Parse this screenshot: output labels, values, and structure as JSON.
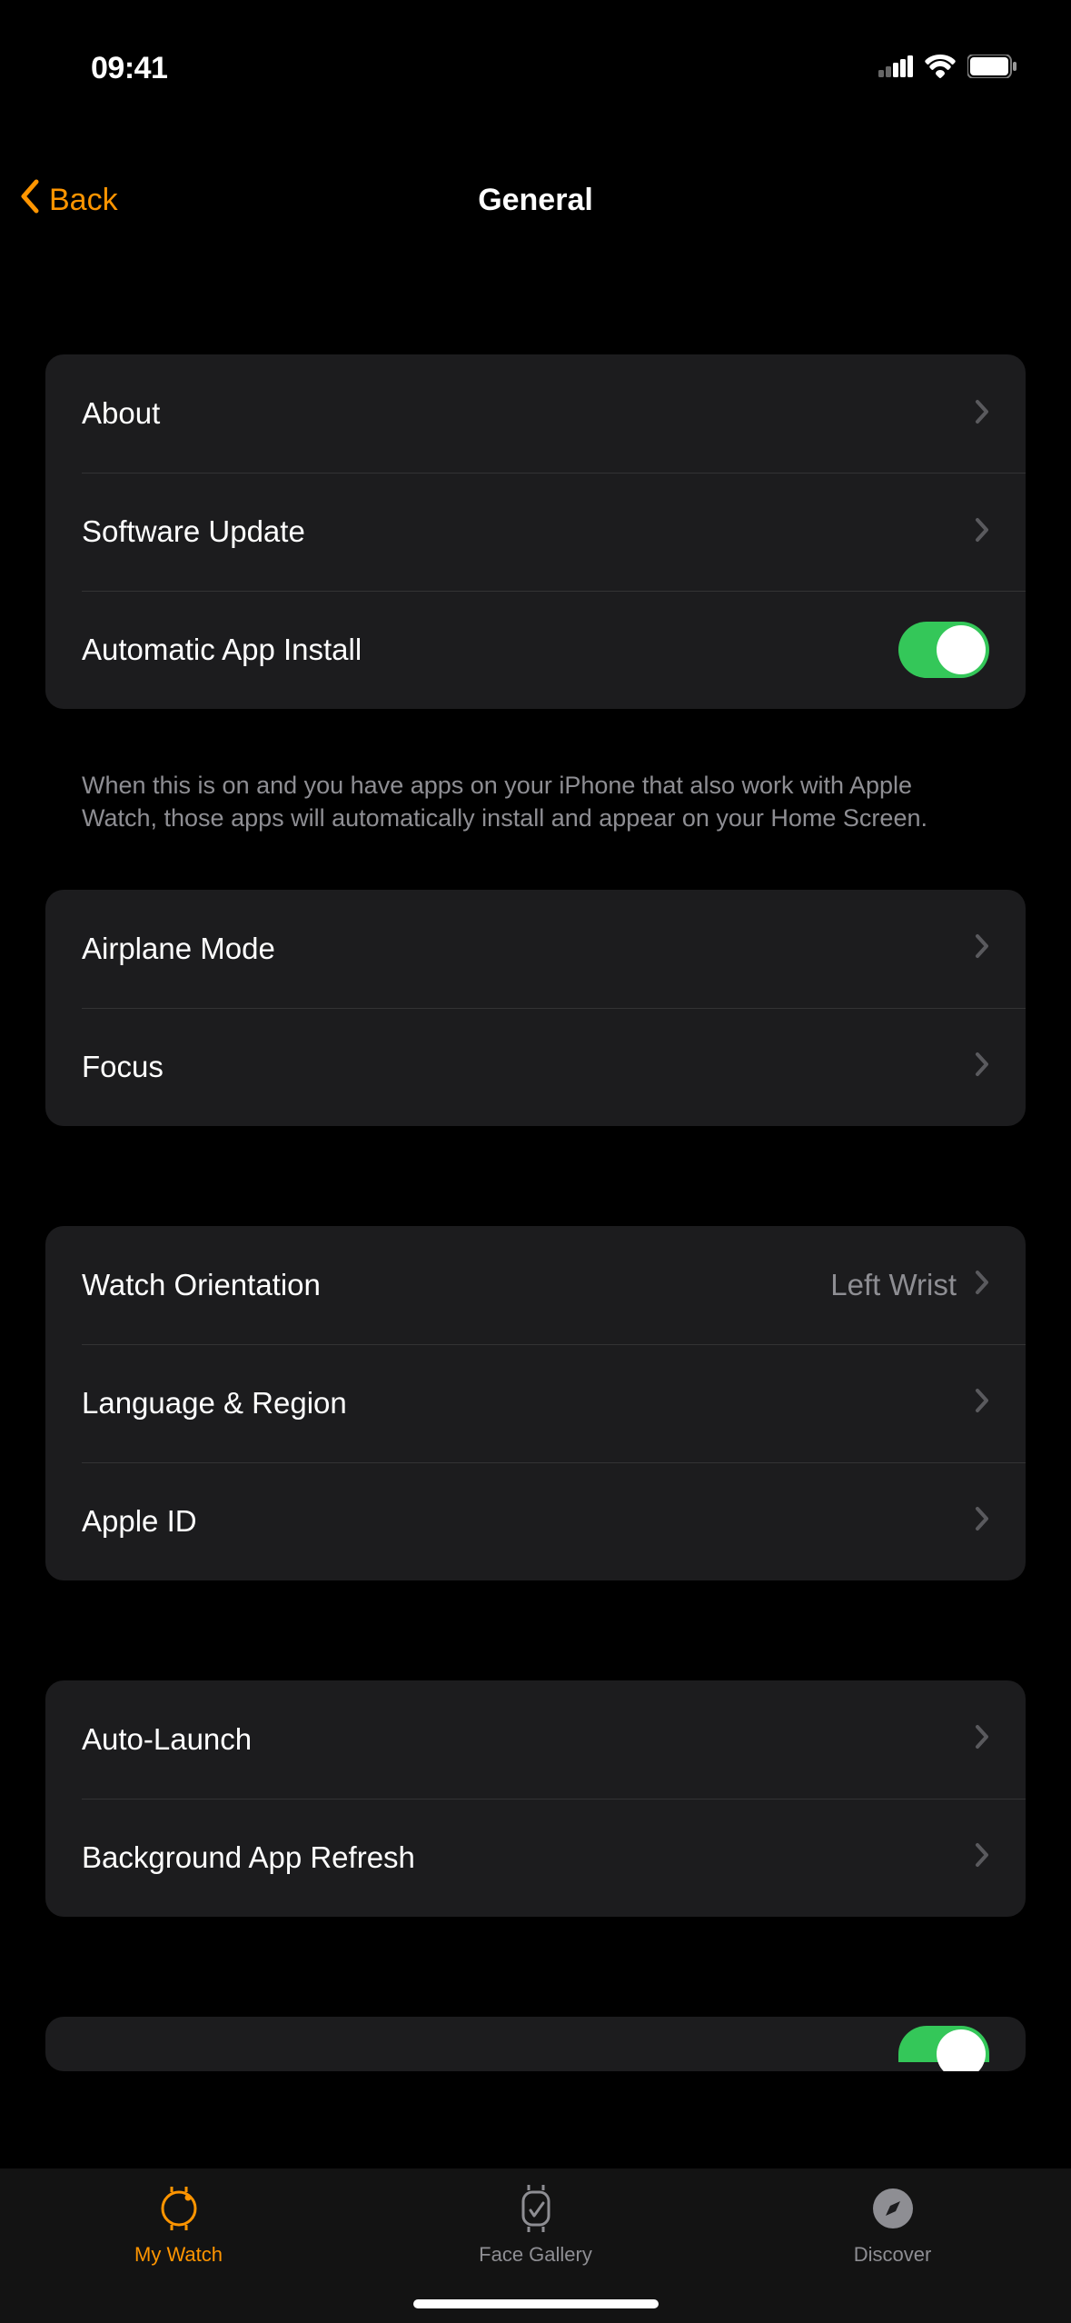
{
  "status": {
    "time": "09:41"
  },
  "nav": {
    "back": "Back",
    "title": "General"
  },
  "groups": {
    "g1": {
      "about": "About",
      "software_update": "Software Update",
      "auto_install": "Automatic App Install",
      "footer": "When this is on and you have apps on your iPhone that also work with Apple Watch, those apps will automatically install and appear on your Home Screen."
    },
    "g2": {
      "airplane": "Airplane Mode",
      "focus": "Focus"
    },
    "g3": {
      "orientation": "Watch Orientation",
      "orientation_value": "Left Wrist",
      "language": "Language & Region",
      "apple_id": "Apple ID"
    },
    "g4": {
      "auto_launch": "Auto-Launch",
      "bg_refresh": "Background App Refresh"
    }
  },
  "tabbar": {
    "my_watch": "My Watch",
    "face_gallery": "Face Gallery",
    "discover": "Discover"
  }
}
